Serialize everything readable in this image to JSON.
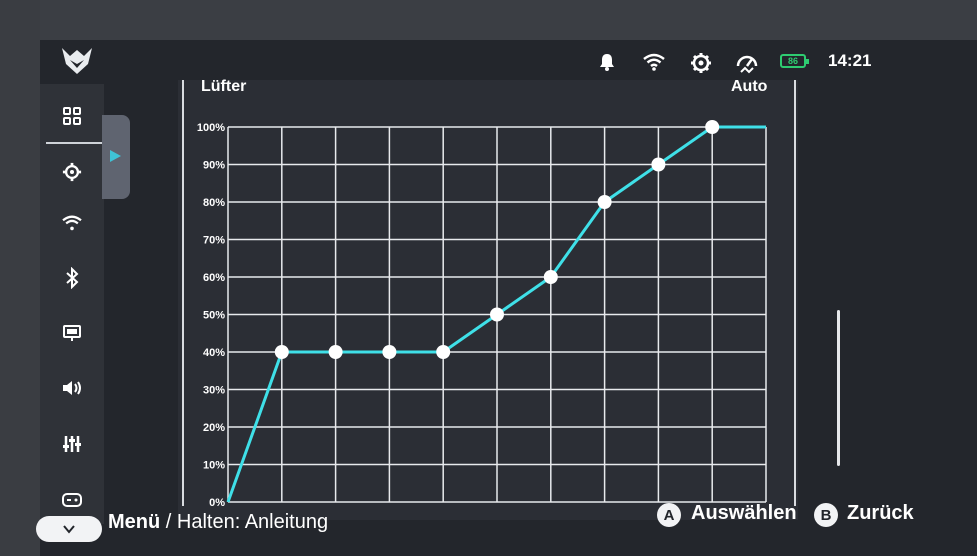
{
  "status": {
    "time": "14:21",
    "battery": "86",
    "icons": [
      "bell-icon",
      "wifi-icon",
      "gear-icon",
      "performance-icon",
      "battery-icon"
    ]
  },
  "sidebar": {
    "items": [
      {
        "icon": "apps-grid-icon"
      },
      {
        "icon": "gear-icon"
      },
      {
        "icon": "wifi-icon"
      },
      {
        "icon": "bluetooth-icon"
      },
      {
        "icon": "display-icon"
      },
      {
        "icon": "volume-icon"
      },
      {
        "icon": "equalizer-icon"
      },
      {
        "icon": "controller-icon"
      }
    ]
  },
  "panel": {
    "title": "Lüfter",
    "mode": "Auto"
  },
  "chart_data": {
    "type": "line",
    "x": [
      0,
      1,
      2,
      3,
      4,
      5,
      6,
      7,
      8,
      9,
      10
    ],
    "values": [
      0,
      40,
      40,
      40,
      40,
      50,
      60,
      80,
      90,
      100,
      100
    ],
    "markers": [
      1,
      2,
      3,
      4,
      5,
      6,
      7,
      8,
      9
    ],
    "ylim": [
      0,
      100
    ],
    "yticks": [
      "0%",
      "10%",
      "20%",
      "30%",
      "40%",
      "50%",
      "60%",
      "70%",
      "80%",
      "90%",
      "100%"
    ],
    "grid": true,
    "color": "#3fe0e8"
  },
  "bottom": {
    "menu_label": "Menü",
    "menu_hint": " / Halten: Anleitung",
    "a_key": "A",
    "a_label": "Auswählen",
    "b_key": "B",
    "b_label": "Zurück"
  },
  "colors": {
    "accent": "#3fe0e8",
    "background": "#23262c",
    "battery": "#2ecc71"
  }
}
